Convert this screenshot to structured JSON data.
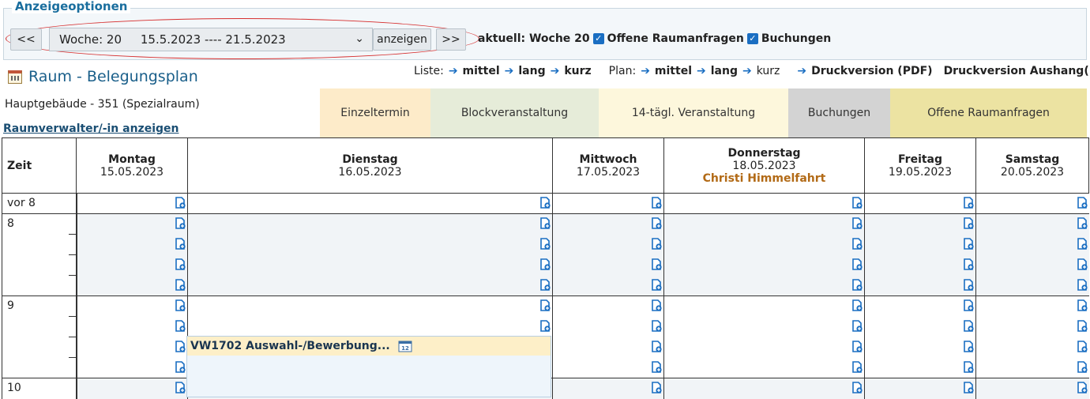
{
  "options": {
    "legend": "Anzeigeoptionen",
    "prev_label": "<<",
    "week_select_value": "Woche: 20     15.5.2023 ---- 21.5.2023",
    "show_label": "anzeigen",
    "next_label": ">>",
    "current_week": "aktuell: Woche 20",
    "check1_label": "Offene Raumanfragen",
    "check2_label": "Buchungen"
  },
  "header": {
    "title": "Raum - Belegungsplan",
    "subtitle": "Hauptgebäude - 351 (Spezialraum)",
    "raumverwalter_link": "Raumverwalter/-in anzeigen",
    "liste_label": "Liste:",
    "plan_label": "Plan:",
    "mittel": "mittel",
    "lang": "lang",
    "kurz": "kurz",
    "druck": "Druckversion (PDF)",
    "druck_aushang": "Druckversion Aushang(PDF)"
  },
  "legend": [
    {
      "label": "Einzeltermin",
      "color": "#fdebc9"
    },
    {
      "label": "Blockveranstaltung",
      "color": "#e6ecd9"
    },
    {
      "label": "14-tägl. Veranstaltung",
      "color": "#fdf7dc"
    },
    {
      "label": "Buchungen",
      "color": "#d3d3d3"
    },
    {
      "label": "Offene Raumanfragen",
      "color": "#ece3a2"
    }
  ],
  "grid": {
    "zeit_header": "Zeit",
    "days": [
      {
        "name": "Montag",
        "date": "15.05.2023",
        "holiday": ""
      },
      {
        "name": "Dienstag",
        "date": "16.05.2023",
        "holiday": ""
      },
      {
        "name": "Mittwoch",
        "date": "17.05.2023",
        "holiday": ""
      },
      {
        "name": "Donnerstag",
        "date": "18.05.2023",
        "holiday": "Christi Himmelfahrt"
      },
      {
        "name": "Freitag",
        "date": "19.05.2023",
        "holiday": ""
      },
      {
        "name": "Samstag",
        "date": "20.05.2023",
        "holiday": ""
      }
    ],
    "hours": [
      "vor 8",
      "8",
      "9",
      "10"
    ]
  },
  "event": {
    "title": "VW1702 Auswahl-/Bewerbung...",
    "icon": "calendar-12-icon"
  },
  "colors": {
    "accent": "#1a6e9e",
    "holiday": "#b26a16",
    "add_icon": "#1a6ec2"
  }
}
